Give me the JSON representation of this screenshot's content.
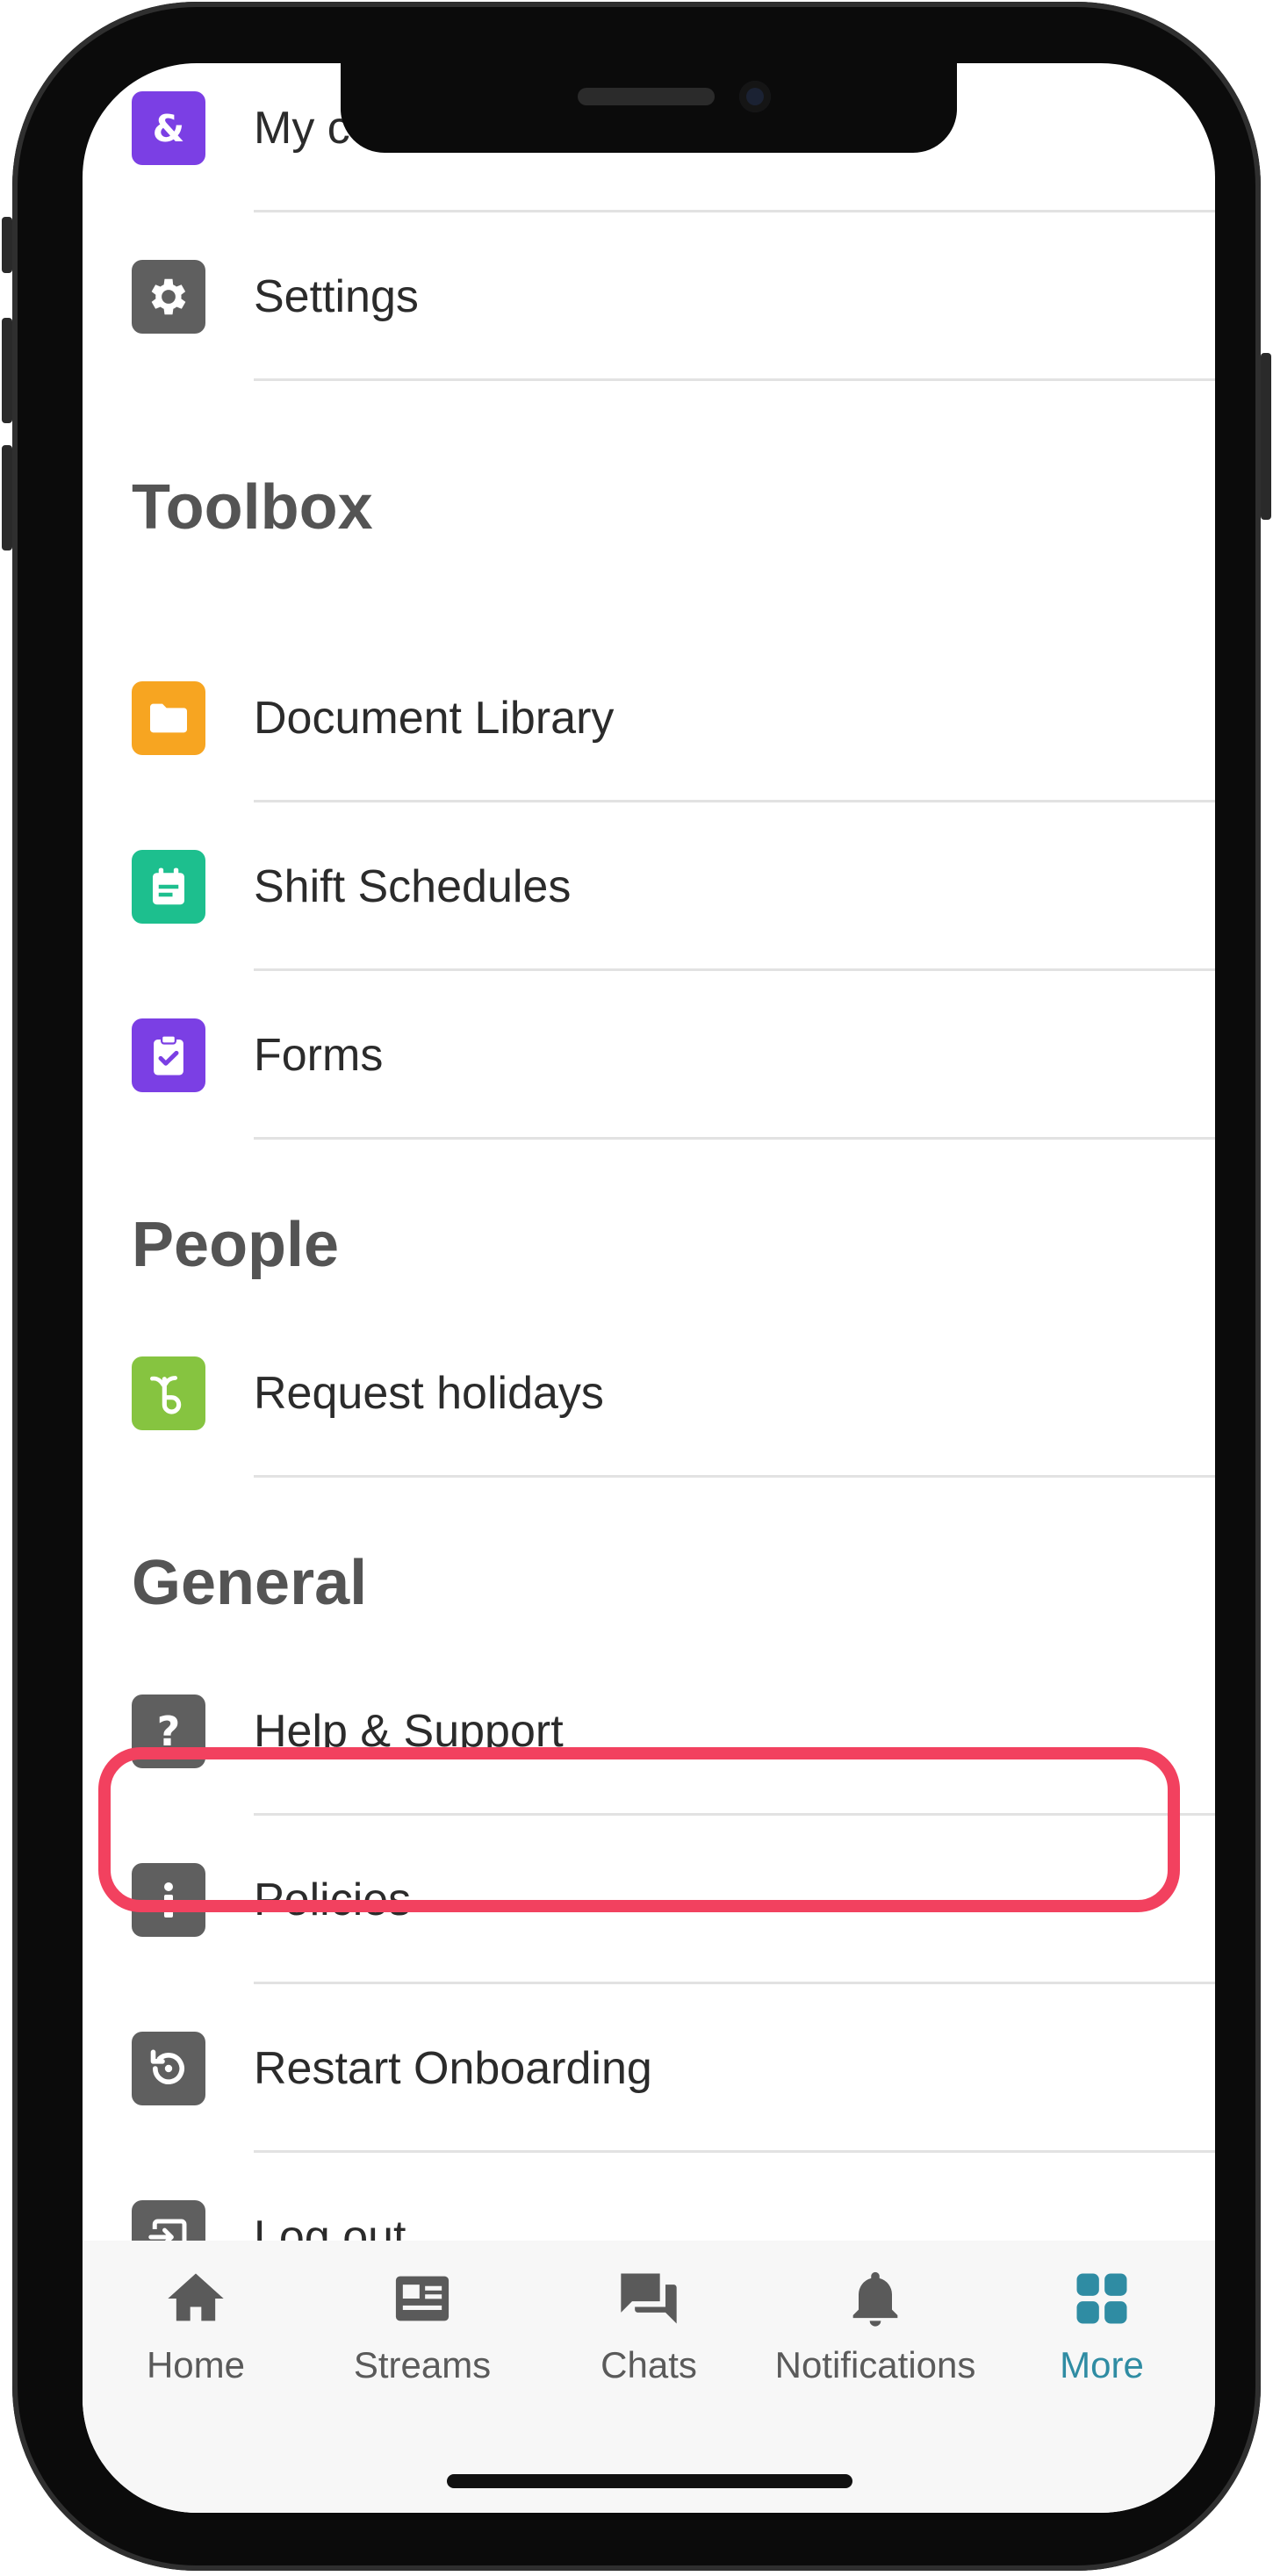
{
  "menu": {
    "top_items": [
      {
        "label": "My company ID",
        "icon": "ampersand-icon",
        "color": "#7b3fe4"
      },
      {
        "label": "Settings",
        "icon": "gear-icon",
        "color": "#5f5f5f"
      }
    ],
    "sections": {
      "toolbox": {
        "title": "Toolbox",
        "items": [
          {
            "label": "Document Library",
            "icon": "folder-icon",
            "color": "#f7a521"
          },
          {
            "label": "Shift Schedules",
            "icon": "calendar-icon",
            "color": "#1dbf8e"
          },
          {
            "label": "Forms",
            "icon": "clipboard-check-icon",
            "color": "#7b3fe4"
          }
        ]
      },
      "people": {
        "title": "People",
        "items": [
          {
            "label": "Request holidays",
            "icon": "holiday-leaf-icon",
            "color": "#86c440"
          }
        ]
      },
      "general": {
        "title": "General",
        "items": [
          {
            "label": "Help & Support",
            "icon": "question-icon",
            "color": "#5f5f5f"
          },
          {
            "label": "Policies",
            "icon": "info-icon",
            "color": "#5f5f5f"
          },
          {
            "label": "Restart Onboarding",
            "icon": "restart-icon",
            "color": "#5f5f5f"
          },
          {
            "label": "Log out",
            "icon": "logout-icon",
            "color": "#5f5f5f"
          }
        ]
      }
    },
    "highlight_color": "#f2415f"
  },
  "tabbar": {
    "tabs": [
      {
        "label": "Home",
        "icon": "home-icon"
      },
      {
        "label": "Streams",
        "icon": "streams-icon"
      },
      {
        "label": "Chats",
        "icon": "chats-icon"
      },
      {
        "label": "Notifications",
        "icon": "bell-icon"
      },
      {
        "label": "More",
        "icon": "grid-icon",
        "active": true
      }
    ],
    "active_color": "#2f8ca3"
  }
}
